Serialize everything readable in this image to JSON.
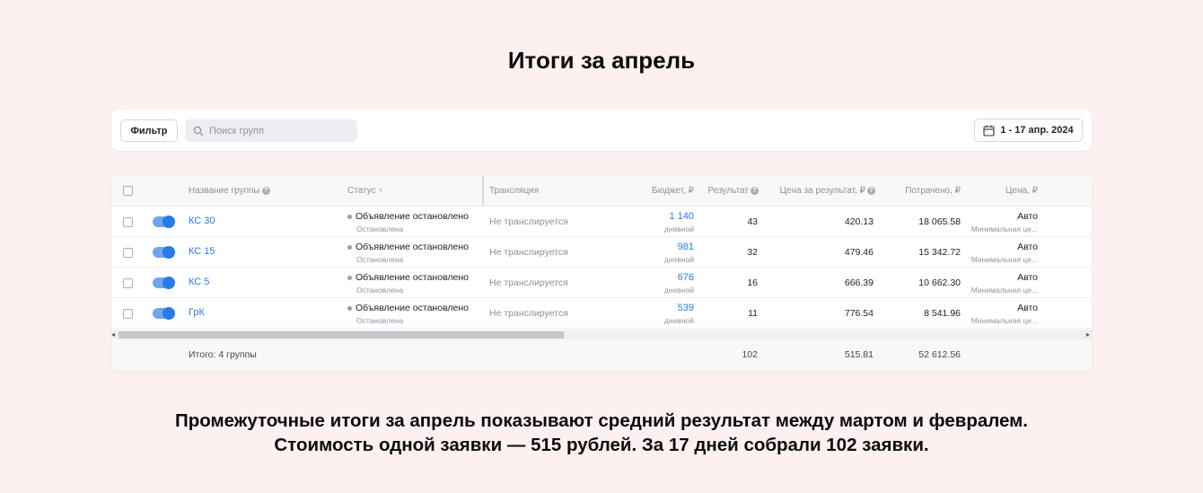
{
  "page": {
    "title": "Итоги за апрель",
    "summary_line1": "Промежуточные итоги за апрель показывают средний результат между мартом и февралем.",
    "summary_line2": "Стоимость одной заявки — 515 рублей. За 17 дней собрали 102 заявки."
  },
  "toolbar": {
    "filter_label": "Фильтр",
    "search_placeholder": "Поиск групп",
    "date_range": "1 - 17 апр. 2024"
  },
  "table": {
    "headers": {
      "name": "Название группы",
      "status": "Статус",
      "sort_arrow": "↑",
      "broadcast": "Трансляция",
      "budget": "Бюджет, ₽",
      "result": "Результат",
      "price_per_result": "Цена за результат, ₽",
      "spent": "Потрачено, ₽",
      "price": "Цена, ₽"
    },
    "rows": [
      {
        "name": "КС 30",
        "status": "Объявление остановлено",
        "status_sub": "Остановлена",
        "broadcast": "Не транслируется",
        "budget": "1 140",
        "budget_sub": "дневной",
        "result": "43",
        "price_per_result": "420.13",
        "spent": "18 065.58",
        "price": "Авто",
        "price_sub": "Минимальная це..."
      },
      {
        "name": "КС 15",
        "status": "Объявление остановлено",
        "status_sub": "Остановлена",
        "broadcast": "Не транслируется",
        "budget": "981",
        "budget_sub": "дневной",
        "result": "32",
        "price_per_result": "479.46",
        "spent": "15 342.72",
        "price": "Авто",
        "price_sub": "Минимальная це..."
      },
      {
        "name": "КС 5",
        "status": "Объявление остановлено",
        "status_sub": "Остановлена",
        "broadcast": "Не транслируется",
        "budget": "676",
        "budget_sub": "дневной",
        "result": "16",
        "price_per_result": "666.39",
        "spent": "10 662.30",
        "price": "Авто",
        "price_sub": "Минимальная це..."
      },
      {
        "name": "ГрК",
        "status": "Объявление остановлено",
        "status_sub": "Остановлена",
        "broadcast": "Не транслируется",
        "budget": "539",
        "budget_sub": "дневной",
        "result": "11",
        "price_per_result": "776.54",
        "spent": "8 541.96",
        "price": "Авто",
        "price_sub": "Минимальная це..."
      }
    ],
    "totals": {
      "label": "Итого: 4 группы",
      "result": "102",
      "price_per_result": "515.81",
      "spent": "52 612.56"
    },
    "scroll_left": "◂",
    "scroll_right": "▸"
  }
}
